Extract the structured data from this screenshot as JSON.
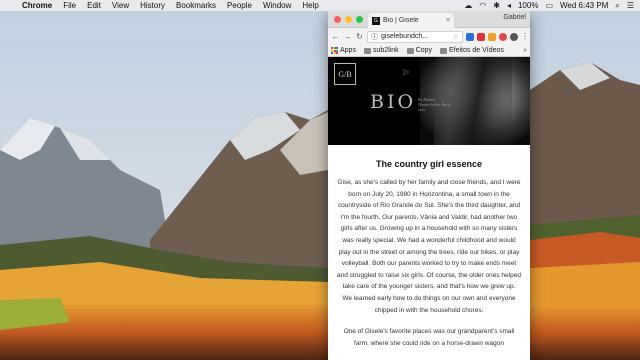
{
  "menubar": {
    "app_name": "Chrome",
    "menus": [
      "File",
      "Edit",
      "View",
      "History",
      "Bookmarks",
      "People",
      "Window",
      "Help"
    ],
    "battery": "100%",
    "clock": "Wed 6:43 PM"
  },
  "browser": {
    "tab_title": "Bio | Gisele",
    "favicon_text": "G",
    "user_name": "Gabriel",
    "url": "giselebundch...",
    "bookmarks": [
      "Apps",
      "sub2link",
      "Copy",
      "Efeitos de Vídeos"
    ],
    "bookmarks_more": "»"
  },
  "page": {
    "logo_text": "G/B",
    "hero_title": "BIO",
    "hero_caption": "By Patrick Demarchelier, Paris, xxxx",
    "article": {
      "heading": "The country girl essence",
      "paragraphs": [
        "Gise, as she's called by her family and close friends, and I were born on July 20, 1980 in Horizontina, a small town in the countryside of Rio Grande do Sul. She's the third daughter, and I'm the fourth. Our parents, Vânia and Valdir, had another two girls after us. Growing up in a household with so many sisters was really special. We had a wonderful childhood and would play out in the street or among the trees, ride our bikes, or play volleyball. Both our parents worked to try to make ends meet and struggled to raise six girls. Of course, the older ones helped take care of the younger sisters, and that's how we grew up. We learned early how to do things on our own and everyone chipped in with the household chores.",
        "One of Gisele's favorite places was our grandparent's small farm, where she could ride on a horse-drawn wagon"
      ]
    }
  }
}
